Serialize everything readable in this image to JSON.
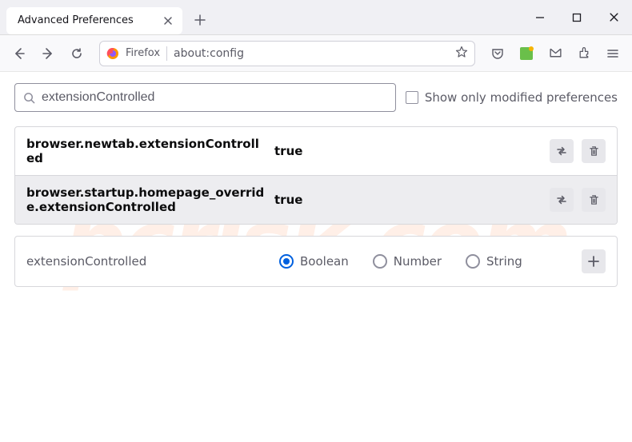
{
  "tab_title": "Advanced Preferences",
  "urlbar": {
    "identity": "Firefox",
    "url": "about:config"
  },
  "search": {
    "value": "extensionControlled",
    "checkbox_label": "Show only modified preferences"
  },
  "prefs": {
    "rows": [
      {
        "name": "browser.newtab.extensionControlled",
        "value": "true"
      },
      {
        "name": "browser.startup.homepage_override.extensionControlled",
        "value": "true"
      }
    ]
  },
  "add_row": {
    "name": "extensionControlled",
    "types": {
      "boolean": "Boolean",
      "number": "Number",
      "string": "String"
    }
  },
  "watermark": "pcrisk.com"
}
